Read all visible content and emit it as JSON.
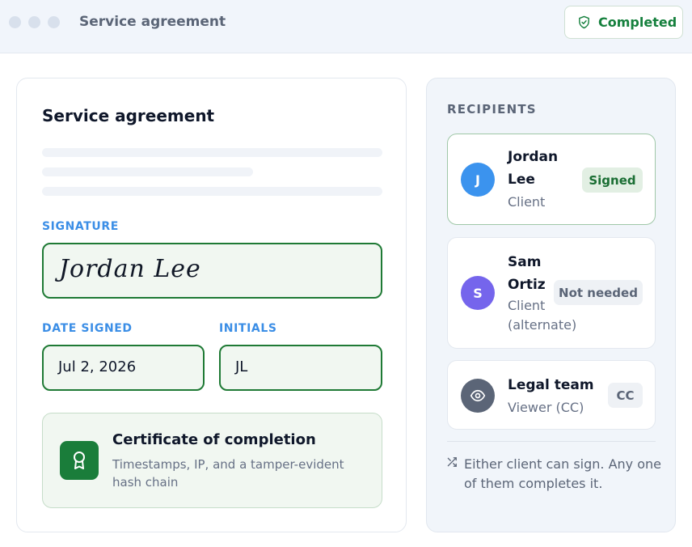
{
  "window": {
    "title": "Service agreement",
    "status_label": "Completed",
    "status_icon": "shield-check-icon",
    "status_color": "#15803d"
  },
  "document": {
    "title": "Service agreement",
    "signature": {
      "label": "SIGNATURE",
      "value": "Jordan Lee"
    },
    "date_signed": {
      "label": "DATE SIGNED",
      "value": "Jul 2, 2026"
    },
    "initials": {
      "label": "INITIALS",
      "value": "JL"
    },
    "certificate": {
      "title": "Certificate of completion",
      "description": "Timestamps, IP, and a tamper-evident hash chain",
      "icon": "award-ribbon-icon"
    }
  },
  "recipients": {
    "heading": "RECIPIENTS",
    "items": [
      {
        "initial": "J",
        "name_line1": "Jordan",
        "name_line2": "Lee",
        "role_line1": "Client",
        "role_line2": "",
        "badge": "Signed",
        "avatar_color": "#3b93ee"
      },
      {
        "initial": "S",
        "name_line1": "Sam",
        "name_line2": "Ortiz",
        "role_line1": "Client",
        "role_line2": "(alternate)",
        "badge": "Not needed",
        "avatar_color": "#7565ec"
      },
      {
        "initial": "",
        "name_line1": "Legal team",
        "name_line2": "",
        "role_line1": "Viewer (CC)",
        "role_line2": "",
        "badge": "CC",
        "avatar_color": "#5b6577",
        "avatar_icon": "eye-icon"
      }
    ],
    "note": "Either client can sign. Any one of them completes it.",
    "note_icon": "shuffle-icon"
  },
  "colors": {
    "accent_blue": "#3b8ee6",
    "success_green": "#1f7a35"
  }
}
